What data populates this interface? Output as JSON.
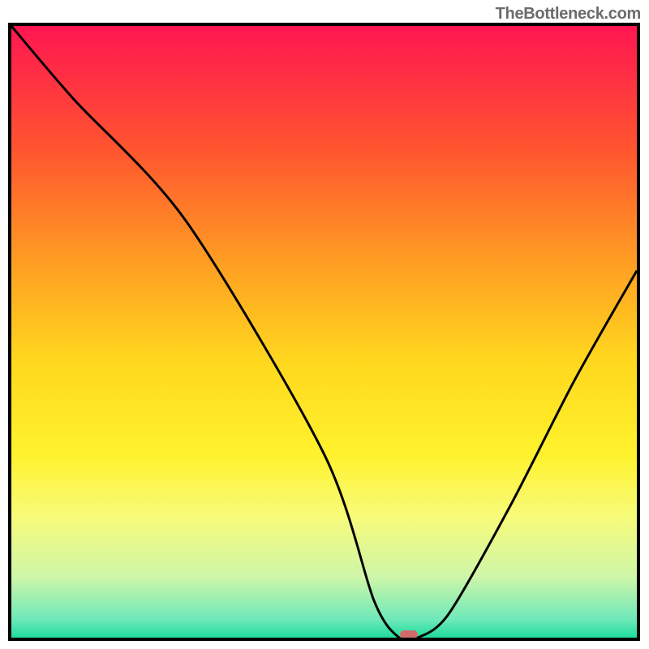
{
  "watermark": "TheBottleneck.com",
  "chart_data": {
    "type": "line",
    "title": "",
    "xlabel": "",
    "ylabel": "",
    "xlim": [
      0,
      100
    ],
    "ylim": [
      0,
      100
    ],
    "series": [
      {
        "name": "bottleneck-curve",
        "x": [
          0,
          10,
          28,
          50,
          58,
          62,
          65,
          70,
          80,
          90,
          100
        ],
        "values": [
          100,
          88,
          68,
          30,
          6,
          0,
          0,
          4,
          22,
          42,
          60
        ]
      }
    ],
    "marker": {
      "x": 63.5,
      "y": 0.5,
      "color": "#d16b6b"
    },
    "background_gradient": {
      "stops": [
        {
          "offset": 0,
          "color": "#ff1651"
        },
        {
          "offset": 20,
          "color": "#ff542f"
        },
        {
          "offset": 40,
          "color": "#ffa322"
        },
        {
          "offset": 55,
          "color": "#ffd81e"
        },
        {
          "offset": 70,
          "color": "#fff22c"
        },
        {
          "offset": 80,
          "color": "#f7fb79"
        },
        {
          "offset": 90,
          "color": "#cff6a8"
        },
        {
          "offset": 97,
          "color": "#6fe9b9"
        },
        {
          "offset": 100,
          "color": "#1fdc9c"
        }
      ]
    }
  }
}
